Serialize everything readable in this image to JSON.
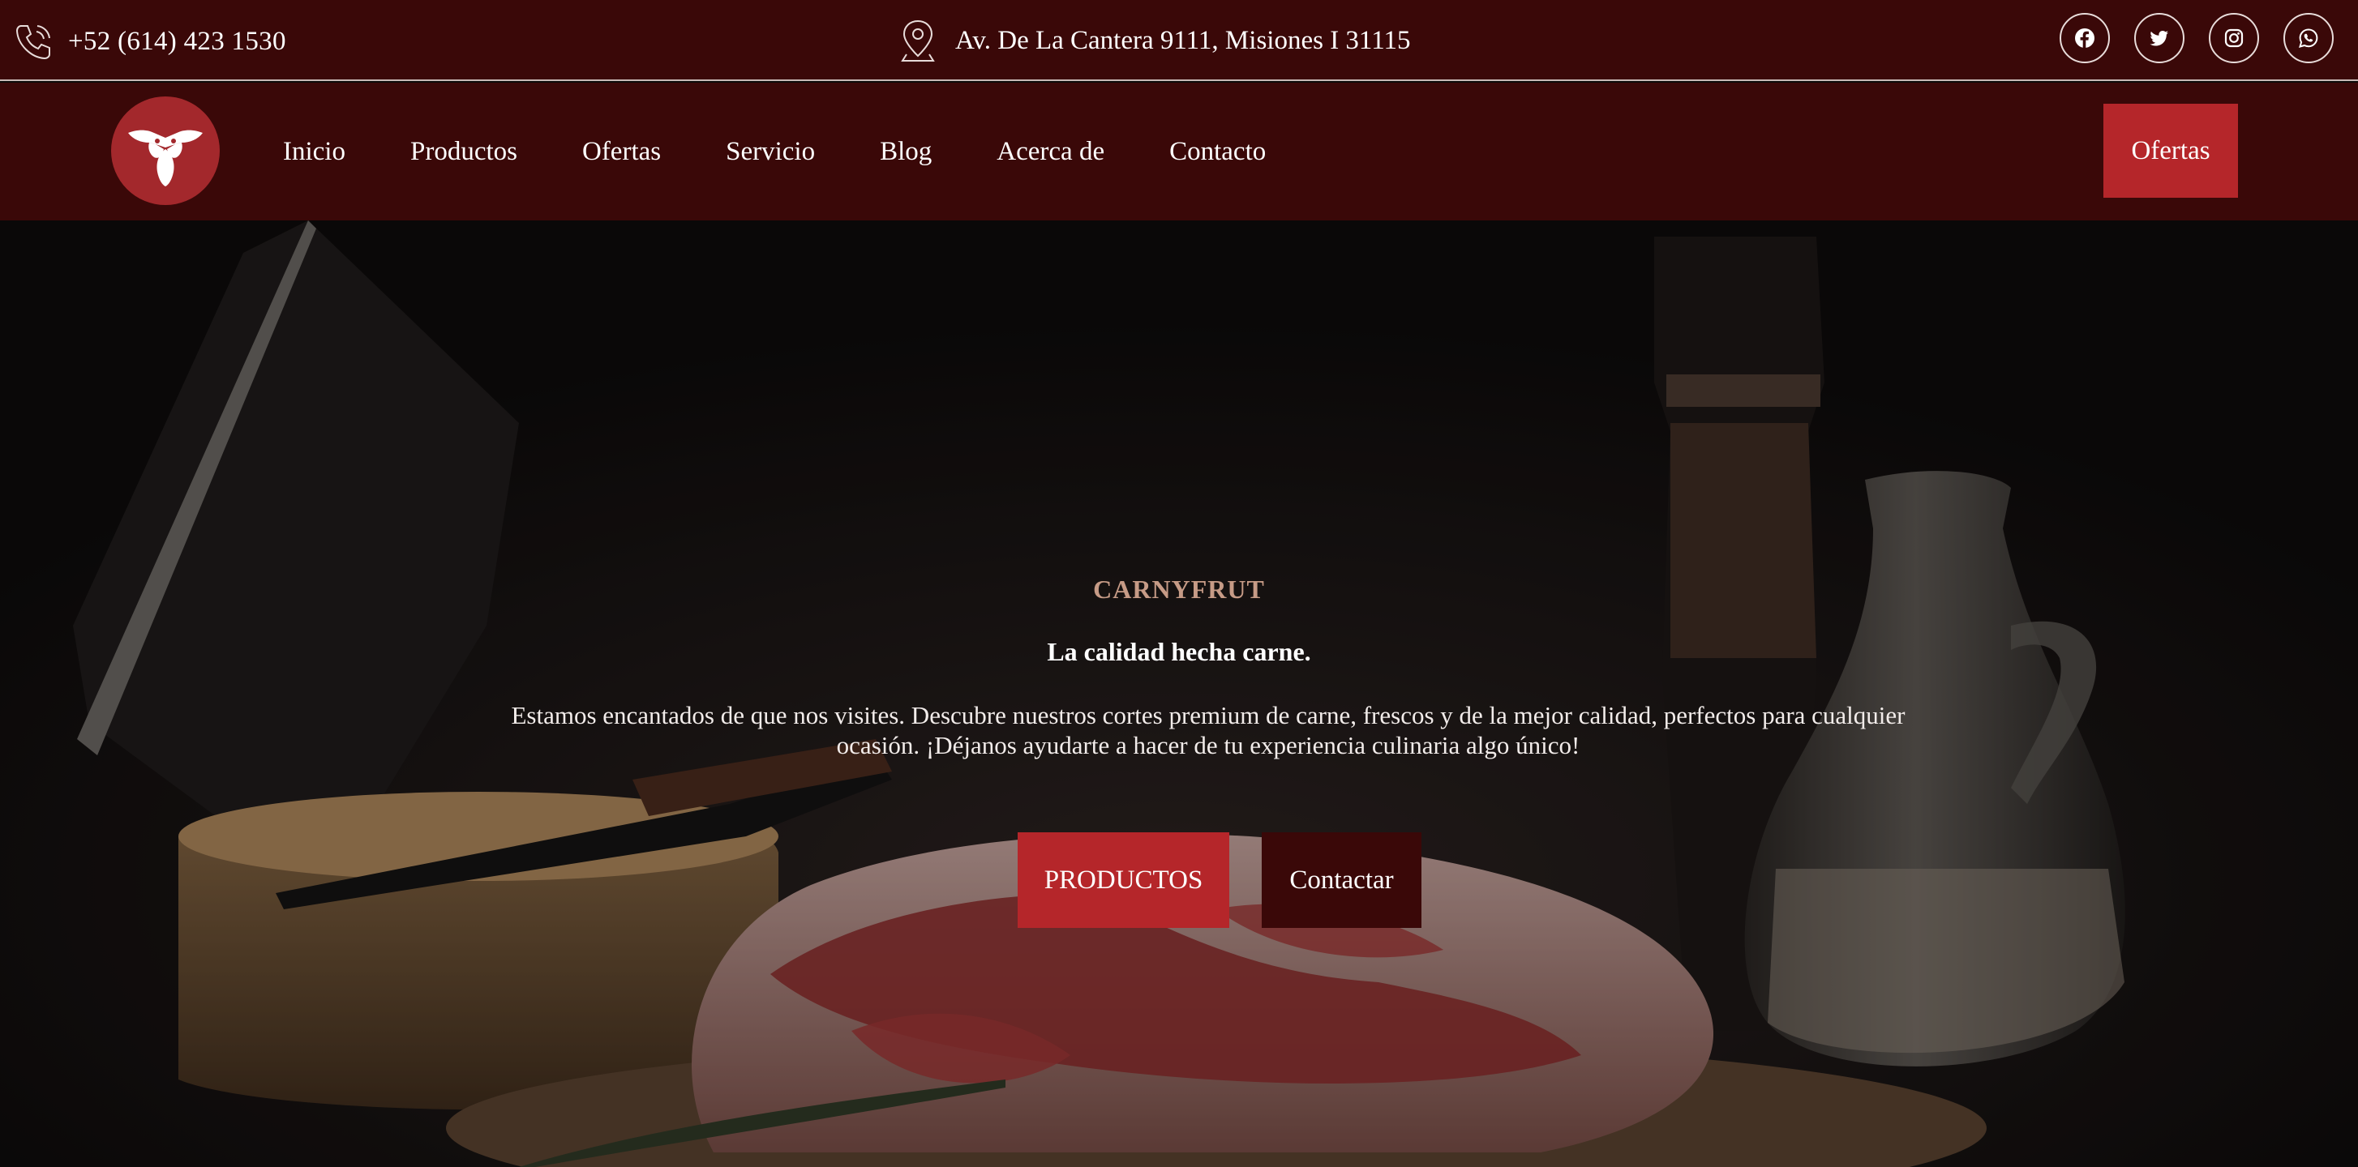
{
  "topbar": {
    "phone": "+52 (614) 423 1530",
    "address": "Av. De La Cantera 9111, Misiones I 31115",
    "social_icons": [
      "facebook-icon",
      "twitter-icon",
      "instagram-icon",
      "whatsapp-icon"
    ]
  },
  "nav": {
    "items": [
      {
        "label": "Inicio"
      },
      {
        "label": "Productos"
      },
      {
        "label": "Ofertas"
      },
      {
        "label": "Servicio"
      },
      {
        "label": "Blog"
      },
      {
        "label": "Acerca de"
      },
      {
        "label": "Contacto"
      }
    ],
    "cta_label": "Ofertas"
  },
  "hero": {
    "eyebrow": "CARNYFRUT",
    "tagline": "La calidad hecha carne.",
    "intro_line1": "Estamos encantados de que nos visites. Descubre nuestros cortes premium de carne, frescos y de la mejor calidad, perfectos para cualquier",
    "intro_line2": "ocasión. ¡Déjanos ayudarte a hacer de tu experiencia culinaria algo único!",
    "primary_button": "PRODUCTOS",
    "secondary_button": "Contactar"
  },
  "colors": {
    "bar_bg": "#3a0808",
    "accent_red": "#b5262a",
    "eyebrow": "#c69b86",
    "logo_bg": "#a3282c"
  }
}
